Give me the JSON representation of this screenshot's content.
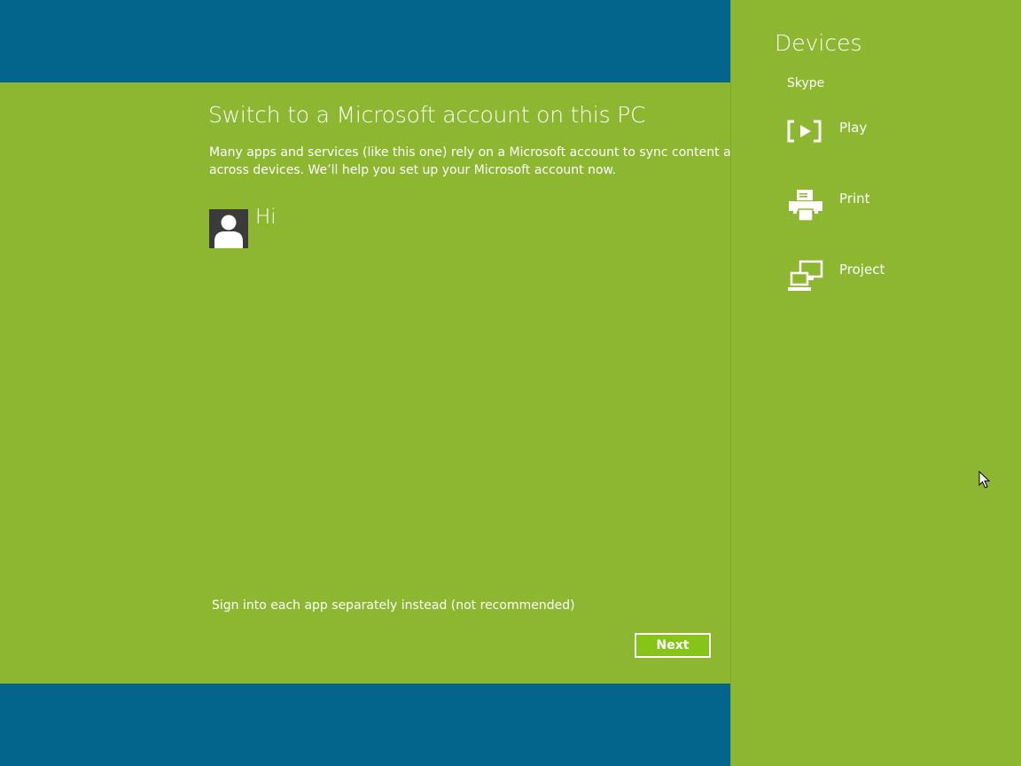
{
  "dialog": {
    "title": "Switch to a Microsoft account on this PC",
    "description_line1": "Many apps and services (like this one) rely on a Microsoft account to sync content and se",
    "description_line2": "across devices. We’ll help you set up your Microsoft account now.",
    "greeting": "Hi",
    "alt_link": "Sign into each app separately instead (not recommended)",
    "next_label": "Next"
  },
  "charm": {
    "title": "Devices",
    "app_name": "Skype",
    "items": [
      {
        "label": "Play",
        "icon": "play-icon"
      },
      {
        "label": "Print",
        "icon": "printer-icon"
      },
      {
        "label": "Project",
        "icon": "project-icon"
      }
    ]
  },
  "colors": {
    "accent_green": "#8db631",
    "background_blue": "#03658c",
    "button_green": "#86c417"
  }
}
